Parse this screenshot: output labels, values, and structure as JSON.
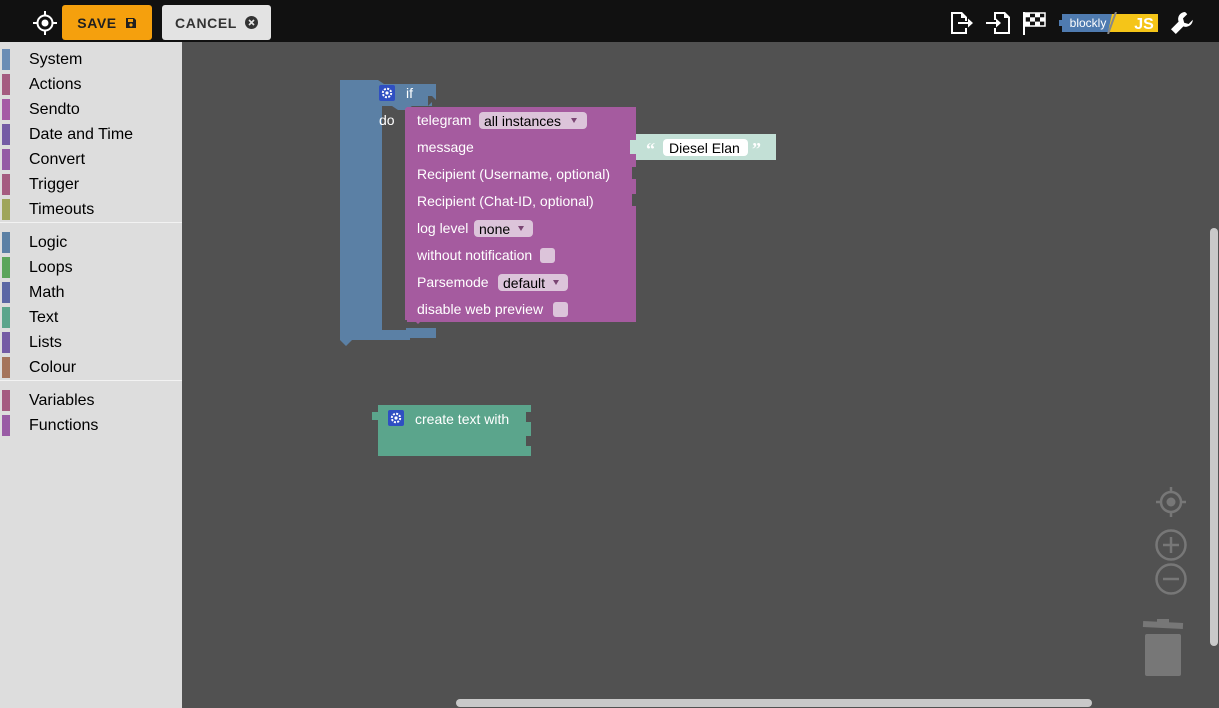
{
  "toolbar": {
    "save_label": "SAVE",
    "cancel_label": "CANCEL",
    "icons": [
      "target-icon",
      "export-icon",
      "import-icon",
      "checkered-flag-icon",
      "blockly-js-logo",
      "wrench-icon"
    ],
    "logo": {
      "left": "blockly",
      "right": "JS"
    }
  },
  "sidebar": {
    "groups": [
      [
        {
          "label": "System",
          "color": "#6b8db5"
        },
        {
          "label": "Actions",
          "color": "#a55b80"
        },
        {
          "label": "Sendto",
          "color": "#a55ba5"
        },
        {
          "label": "Date and Time",
          "color": "#745ba5"
        },
        {
          "label": "Convert",
          "color": "#945ba5"
        },
        {
          "label": "Trigger",
          "color": "#a55b80"
        },
        {
          "label": "Timeouts",
          "color": "#9fa55b"
        }
      ],
      [
        {
          "label": "Logic",
          "color": "#5b80a5"
        },
        {
          "label": "Loops",
          "color": "#5ba55b"
        },
        {
          "label": "Math",
          "color": "#5b67a5"
        },
        {
          "label": "Text",
          "color": "#5ba58c"
        },
        {
          "label": "Lists",
          "color": "#745ba5"
        },
        {
          "label": "Colour",
          "color": "#a5745b"
        }
      ],
      [
        {
          "label": "Variables",
          "color": "#a55b80"
        },
        {
          "label": "Functions",
          "color": "#995ba5"
        }
      ]
    ]
  },
  "workspace": {
    "if_block": {
      "if_label": "if",
      "do_label": "do",
      "color": "#5b80a5"
    },
    "telegram_block": {
      "color": "#a55b9f",
      "title": "telegram",
      "instance_dropdown": "all instances",
      "message_label": "message",
      "recipient_username_label": "Recipient (Username, optional)",
      "recipient_chatid_label": "Recipient (Chat-ID, optional)",
      "log_level_label": "log level",
      "log_level_dropdown": "none",
      "without_notification_label": "without notification",
      "parsemode_label": "Parsemode",
      "parsemode_dropdown": "default",
      "disable_web_preview_label": "disable web preview"
    },
    "text_block": {
      "color": "#c3e0d6",
      "value": "Diesel Elan",
      "open_quote": "“",
      "close_quote": "”"
    },
    "create_text_block": {
      "color": "#5ba58c",
      "label": "create text with"
    }
  },
  "controls": {
    "icons": [
      "recenter-icon",
      "zoom-in-icon",
      "zoom-out-icon",
      "trash-icon"
    ]
  }
}
